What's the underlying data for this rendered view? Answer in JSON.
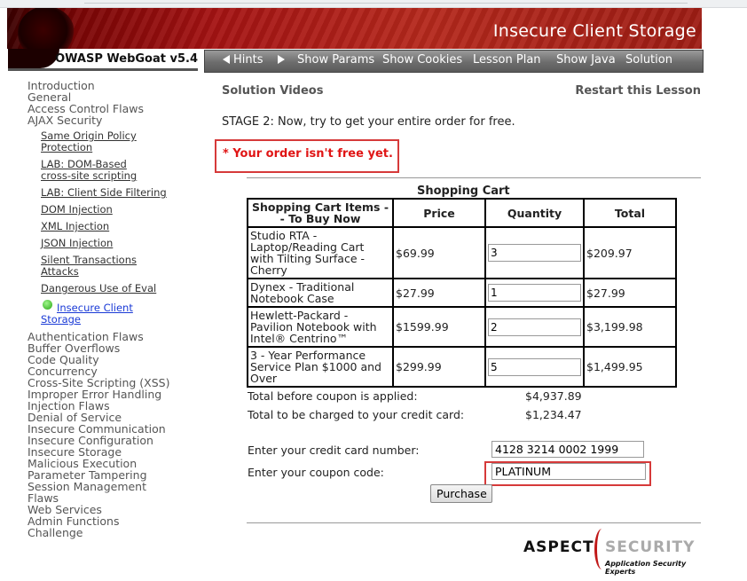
{
  "header": {
    "title": "Insecure Client Storage",
    "brand": "OWASP WebGoat v5.4"
  },
  "nav": {
    "hints": "Hints",
    "show_params": "Show Params",
    "show_cookies": "Show Cookies",
    "lesson_plan": "Lesson Plan",
    "show_java": "Show Java",
    "solution": "Solution"
  },
  "menu": {
    "introduction": "Introduction",
    "general": "General",
    "access_control": "Access Control Flaws",
    "ajax_security": "AJAX Security",
    "ajax_items": [
      "Same Origin Policy Protection",
      "LAB: DOM-Based cross-site scripting",
      "LAB: Client Side Filtering",
      "DOM Injection",
      "XML Injection",
      "JSON Injection",
      "Silent Transactions Attacks",
      "Dangerous Use of Eval",
      "Insecure Client Storage"
    ],
    "after": [
      "Authentication Flaws",
      "Buffer Overflows",
      "Code Quality",
      "Concurrency",
      "Cross-Site Scripting (XSS)",
      "Improper Error Handling",
      "Injection Flaws",
      "Denial of Service",
      "Insecure Communication",
      "Insecure Configuration",
      "Insecure Storage",
      "Malicious Execution",
      "Parameter Tampering",
      "Session Management Flaws",
      "Web Services",
      "Admin Functions",
      "Challenge"
    ]
  },
  "content": {
    "solution_videos": "Solution Videos",
    "restart": "Restart this Lesson",
    "stage": "STAGE 2: Now, try to get your entire order for free.",
    "error": "* Your order isn't free yet.",
    "cart_title": "Shopping Cart",
    "headers": {
      "items": "Shopping Cart Items -- To Buy Now",
      "price": "Price",
      "quantity": "Quantity",
      "total": "Total"
    },
    "rows": [
      {
        "item": "Studio RTA - Laptop/Reading Cart with Tilting Surface - Cherry",
        "price": "$69.99",
        "qty": "3",
        "total": "$209.97"
      },
      {
        "item": "Dynex - Traditional Notebook Case",
        "price": "$27.99",
        "qty": "1",
        "total": "$27.99"
      },
      {
        "item": "Hewlett-Packard - Pavilion Notebook with Intel® Centrino™",
        "price": "$1599.99",
        "qty": "2",
        "total": "$3,199.98"
      },
      {
        "item": "3 - Year Performance Service Plan $1000 and Over",
        "price": "$299.99",
        "qty": "5",
        "total": "$1,499.95"
      }
    ],
    "total_before_label": "Total before coupon is applied:",
    "total_before": "$4,937.89",
    "total_charged_label": "Total to be charged to your credit card:",
    "total_charged": "$1,234.47",
    "cc_label": "Enter your credit card number:",
    "cc_value": "4128 3214 0002 1999",
    "coupon_label": "Enter your coupon code:",
    "coupon_value": "PLATINUM",
    "purchase": "Purchase"
  },
  "footer": {
    "logo_part1": "ASPECT",
    "logo_part2": "SECURITY",
    "tagline": "Application Security Experts"
  }
}
